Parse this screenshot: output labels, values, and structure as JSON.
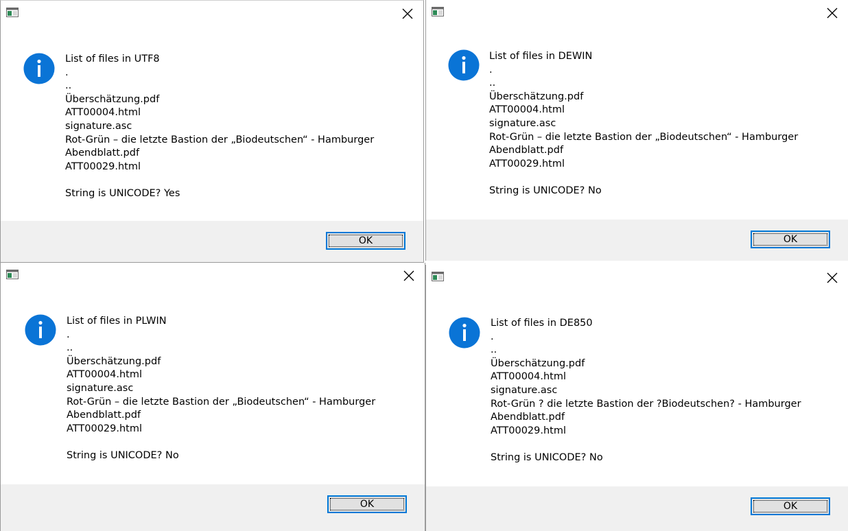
{
  "dialogs": [
    {
      "lines": [
        "List of files in UTF8",
        ".",
        "..",
        "Überschätzung.pdf",
        "ATT00004.html",
        "signature.asc",
        "Rot-Grün – die letzte Bastion der „Biodeutschen“ - Hamburger",
        "Abendblatt.pdf",
        "ATT00029.html",
        "",
        "String is UNICODE? Yes"
      ],
      "ok_label": "OK"
    },
    {
      "lines": [
        "List of files in DEWIN",
        ".",
        "..",
        "Überschätzung.pdf",
        "ATT00004.html",
        "signature.asc",
        "Rot-Grün – die letzte Bastion der „Biodeutschen“ - Hamburger",
        "Abendblatt.pdf",
        "ATT00029.html",
        "",
        "String is UNICODE? No"
      ],
      "ok_label": "OK"
    },
    {
      "lines": [
        "List of files in PLWIN",
        ".",
        "..",
        "Überschätzung.pdf",
        "ATT00004.html",
        "signature.asc",
        "Rot-Grün – die letzte Bastion der „Biodeutschen“ - Hamburger",
        "Abendblatt.pdf",
        "ATT00029.html",
        "",
        "String is UNICODE? No"
      ],
      "ok_label": "OK"
    },
    {
      "lines": [
        "List of files in DE850",
        ".",
        "..",
        "Überschätzung.pdf",
        "ATT00004.html",
        "signature.asc",
        "Rot-Grün ? die letzte Bastion der ?Biodeutschen? - Hamburger",
        "Abendblatt.pdf",
        "ATT00029.html",
        "",
        "String is UNICODE? No"
      ],
      "ok_label": "OK"
    }
  ],
  "icons": {
    "info": "info-icon",
    "close": "close-icon",
    "app": "app-icon"
  },
  "colors": {
    "info_blue": "#0a74d6",
    "accent": "#0078d7",
    "footer_bg": "#f0f0f0",
    "button_bg": "#e1e1e1"
  }
}
